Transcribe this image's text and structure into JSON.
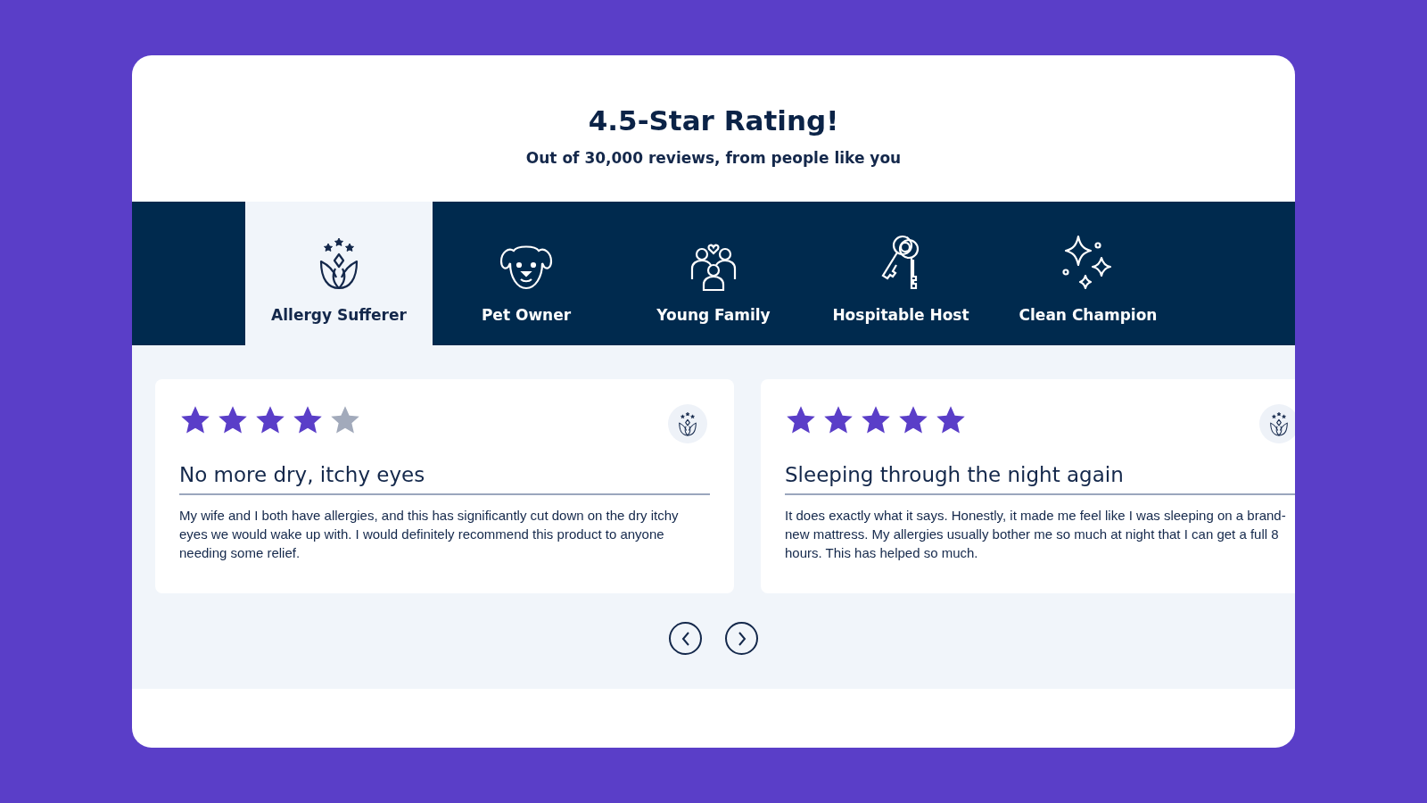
{
  "header": {
    "title": "4.5-Star Rating!",
    "subtitle": "Out of 30,000 reviews, from people like you"
  },
  "tabs": [
    {
      "label": "Allergy Sufferer",
      "selected": true
    },
    {
      "label": "Pet Owner",
      "selected": false
    },
    {
      "label": "Young Family",
      "selected": false
    },
    {
      "label": "Hospitable Host",
      "selected": false
    },
    {
      "label": "Clean Champion",
      "selected": false
    }
  ],
  "reviews": [
    {
      "stars": 4,
      "title": "No more dry, itchy eyes",
      "body": "My wife and I both have allergies, and this has significantly cut down on the dry itchy eyes we would wake up with. I would definitely recommend this product to anyone needing some relief."
    },
    {
      "stars": 5,
      "title": "Sleeping through the night again",
      "body": "It does exactly what it says. Honestly, it made me feel like I was sleeping on a brand-new mattress. My allergies usually bother me so much at night that I can get a full 8 hours. This has helped so much."
    }
  ]
}
